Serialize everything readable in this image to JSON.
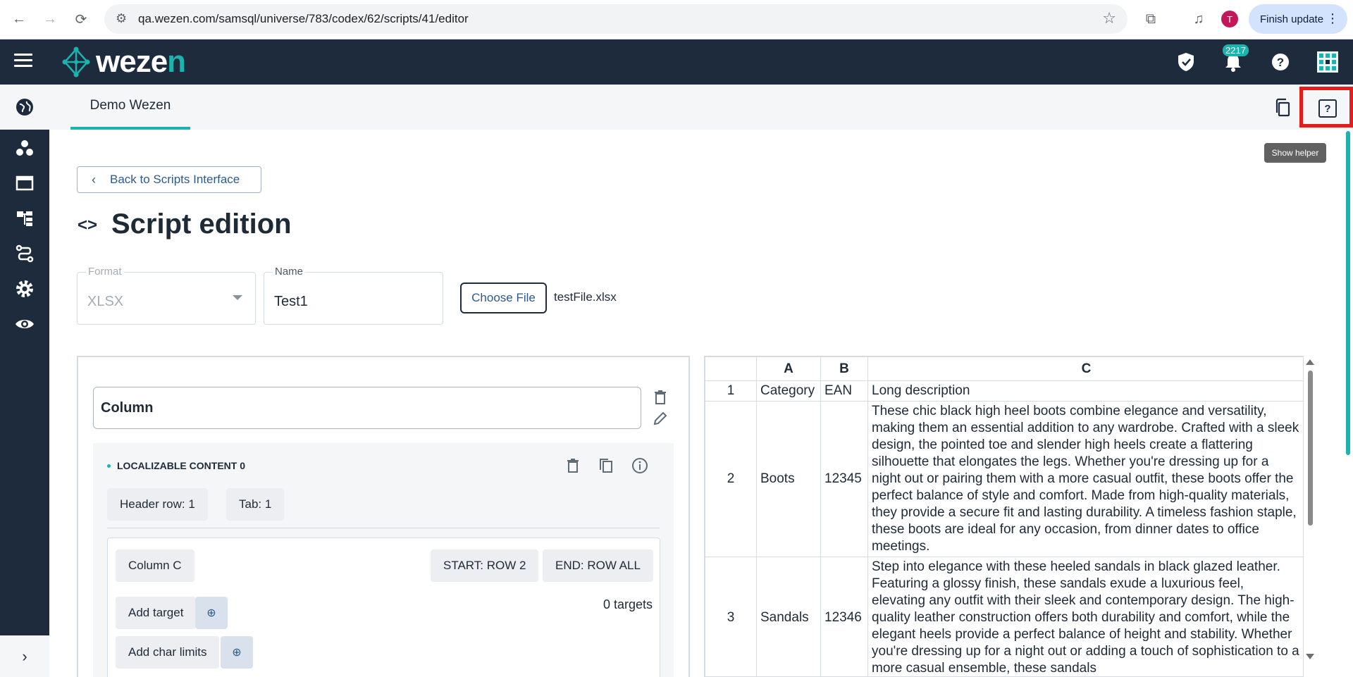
{
  "browser": {
    "url": "qa.wezen.com/samsql/universe/783/codex/62/scripts/41/editor",
    "profile_initial": "T",
    "finish_update_label": "Finish update"
  },
  "header": {
    "logo_part1": "weze",
    "logo_part2": "n",
    "notification_count": "2217"
  },
  "tabs": {
    "active_label": "Demo Wezen",
    "help_tooltip": "Show helper"
  },
  "main": {
    "back_label": "Back to Scripts Interface",
    "title": "Script edition",
    "format_label": "Format",
    "format_value": "XLSX",
    "name_label": "Name",
    "name_value": "Test1",
    "choose_file_label": "Choose File",
    "file_name": "testFile.xlsx"
  },
  "editor": {
    "column_name": "Column",
    "localizable_title": "LOCALIZABLE CONTENT 0",
    "header_row": "Header row: 1",
    "tab": "Tab: 1",
    "column_label": "Column C",
    "start_row": "START: ROW 2",
    "end_row": "END: ROW ALL",
    "add_target": "Add target",
    "targets_count": "0 targets",
    "add_char_limits": "Add char limits"
  },
  "sheet": {
    "columns": [
      "A",
      "B",
      "C"
    ],
    "rows": [
      {
        "num": "1",
        "a": "Category",
        "b": "EAN",
        "c": "Long description"
      },
      {
        "num": "2",
        "a": "Boots",
        "b": "12345",
        "c": "These chic black high heel boots combine elegance and versatility, making them an essential addition to any wardrobe. Crafted with a sleek design, the pointed toe and slender high heels create a flattering silhouette that elongates the legs. Whether you're dressing up for a night out or pairing them with a more casual outfit, these boots offer the perfect balance of style and comfort. Made from high-quality materials, they provide a secure fit and lasting durability. A timeless fashion staple, these boots are ideal for any occasion, from dinner dates to office meetings."
      },
      {
        "num": "3",
        "a": "Sandals",
        "b": "12346",
        "c": "Step into elegance with these heeled sandals in black glazed leather. Featuring a glossy finish, these sandals exude a luxurious feel, elevating any outfit with their sleek and contemporary design. The high-quality leather construction offers both durability and comfort, while the elegant heels provide a perfect balance of height and stability. Whether you're dressing up for a night out or adding a touch of sophistication to a more casual ensemble, these sandals"
      }
    ]
  },
  "colors": {
    "accent": "#1ab3ad",
    "nav_bg": "#1d2b3c",
    "highlight": "#e41c1c"
  }
}
